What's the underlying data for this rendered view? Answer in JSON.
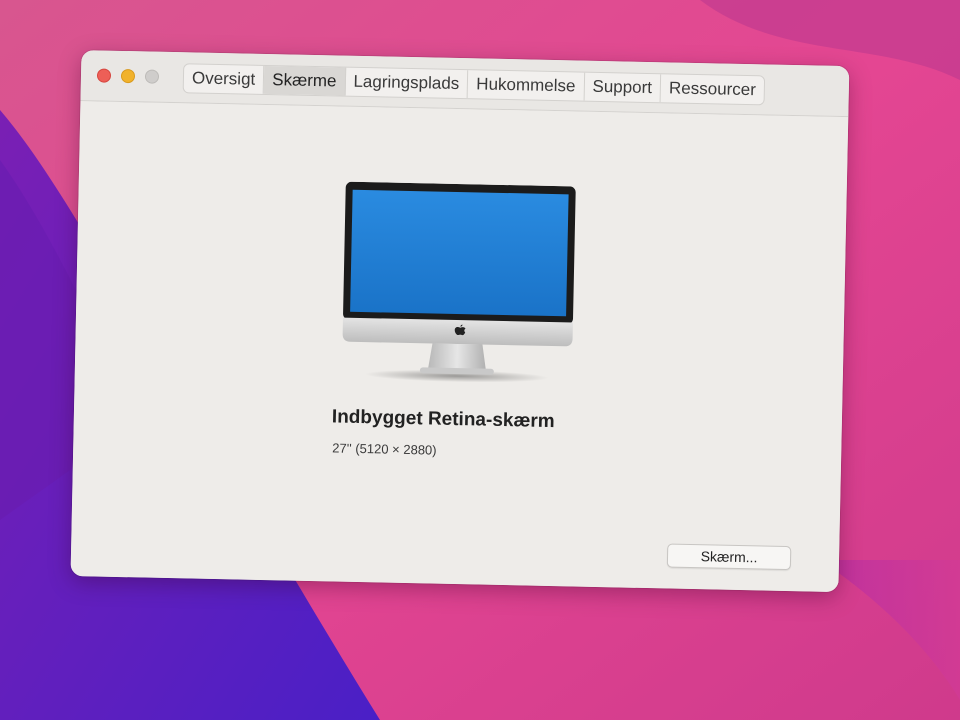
{
  "window": {
    "tabs": [
      {
        "label": "Oversigt",
        "active": false
      },
      {
        "label": "Skærme",
        "active": true
      },
      {
        "label": "Lagringsplads",
        "active": false
      },
      {
        "label": "Hukommelse",
        "active": false
      },
      {
        "label": "Support",
        "active": false
      },
      {
        "label": "Ressourcer",
        "active": false
      }
    ]
  },
  "display": {
    "name": "Indbygget Retina-skærm",
    "size": "27'' (5120 × 2880)",
    "icon": "imac-icon"
  },
  "footer": {
    "button_label": "Skærm..."
  },
  "colors": {
    "wallpaper_pink": "#e0478f",
    "wallpaper_purple": "#5a1fbf",
    "screen_blue": "#1f7fd6",
    "traffic_close": "#ed5f57",
    "traffic_minimize": "#f1b22b",
    "traffic_zoom_inactive": "#cfcdcb"
  }
}
